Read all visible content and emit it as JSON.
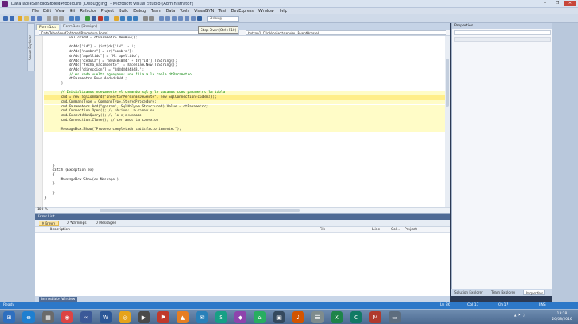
{
  "window": {
    "title": "DataTableSendToStoredProcedure (Debugging) - Microsoft Visual Studio (Administrator)",
    "minimize": "–",
    "restore": "❐",
    "close": "✕"
  },
  "menu": [
    "File",
    "Edit",
    "View",
    "Git",
    "Refactor",
    "Project",
    "Build",
    "Debug",
    "Team",
    "Data",
    "Tools",
    "VisualSVN",
    "Test",
    "DevExpress",
    "Window",
    "Help"
  ],
  "toolbar": {
    "config": "Debug"
  },
  "tooltip": "Step Over (Ctrl+F10)",
  "leftstrip": {
    "vtab": "Server Explorer"
  },
  "tabs": [
    {
      "label": "Form1.cs"
    },
    {
      "label": "Form1.cs [Design]"
    }
  ],
  "navbar": {
    "left": "DataTableSendToStoredProcedure.Form1",
    "right": "button1_Click(object sender, EventArgs e)"
  },
  "code": [
    "            var drAdd = dtParametro.NewRow();",
    "",
    "            drAdd[\"id\"] = (int)dr[\"id\"] + 1;",
    "            drAdd[\"nombre\"] = dr[\"nombre\"];",
    "            drAdd[\"apellido\"] = \"Mi apellido\";",
    "            drAdd[\"cedula\"] = \"840484084\" + dr[\"id\"].ToString();",
    "            drAdd[\"fecha_nacimiento\"] = DateTime.Now.ToString();",
    "            drAdd[\"direccion\"] = \"84848484848.\";",
    "            // en cada vuelta agregamos una fila a la tabla dtParametro",
    "            dtParametro.Rows.Add(drAdd);",
    "        }",
    "",
    "        // Inicializamos nuevamente el comando sql y le pasamos como parametro la tabla",
    "        cmd = new SqlCommand(\"InsertarPersonasDeGente\", new SqlConnection(cadena));",
    "        cmd.CommandType = CommandType.StoredProcedure;",
    "        cmd.Parameters.Add(\"@param\", SqlDbType.Structured).Value = dtParametro;",
    "        cmd.Connection.Open(); // abrimos la conexion",
    "        cmd.ExecuteNonQuery(); // lo ejecutamos",
    "        cmd.Connection.Close(); // cerramos la conexion",
    "",
    "        MessageBox.Show(\"Proceso completado satisfactoriamente.\");",
    "",
    "",
    "",
    "",
    "",
    "",
    "",
    "    }",
    "    catch (Exception ex)",
    "    {",
    "        MessageBox.Show(ex.Message );",
    "    }",
    "",
    "    }",
    "}"
  ],
  "editor": {
    "zoom": "100 %"
  },
  "errorlist": {
    "title": "Error List",
    "filters": [
      "0 Errors",
      "0 Warnings",
      "0 Messages"
    ],
    "columns": [
      "Description",
      "File",
      "Line",
      "Col...",
      "Project"
    ]
  },
  "immediate": {
    "tab": "Immediate Window"
  },
  "properties": {
    "title": "Properties"
  },
  "righttabs": [
    "Solution Explorer",
    "Team Explorer",
    "Properties"
  ],
  "status": {
    "left": "Ready",
    "ln": "Ln 86",
    "col": "Col 17",
    "ch": "Ch 17",
    "mode": "INS"
  },
  "taskbar": {
    "icons": [
      "⊞",
      "e",
      "▦",
      "◉",
      "∞",
      "W",
      "◎",
      "▶",
      "⚑",
      "▲",
      "✉",
      "S",
      "◆",
      "⌂",
      "▣",
      "♪",
      "☰",
      "X",
      "C",
      "M",
      "▭"
    ],
    "time": "13:18",
    "date": "26/08/2016"
  }
}
